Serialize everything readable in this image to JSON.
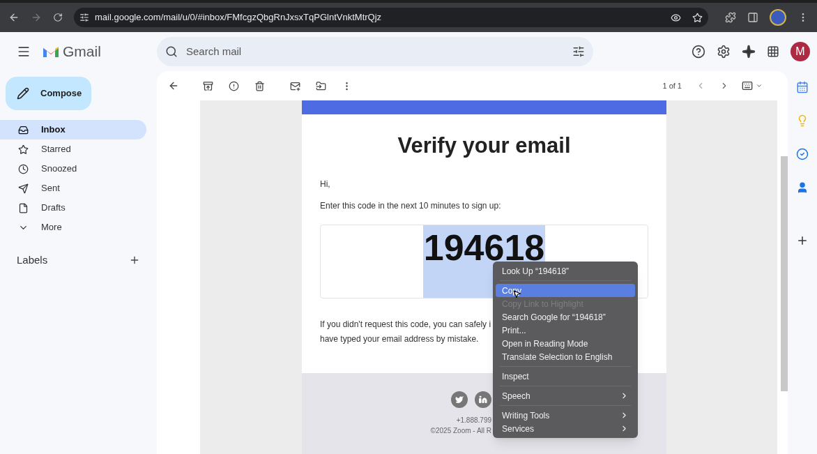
{
  "browser": {
    "url": "mail.google.com/mail/u/0/#inbox/FMfcgzQbgRnJxsxTqPGlntVnktMtrQjz"
  },
  "header": {
    "app_name": "Gmail",
    "search": {
      "placeholder": "Search mail"
    },
    "avatar": "M"
  },
  "sidebar": {
    "compose": "Compose",
    "items": [
      {
        "label": "Inbox",
        "selected": true
      },
      {
        "label": "Starred",
        "selected": false
      },
      {
        "label": "Snoozed",
        "selected": false
      },
      {
        "label": "Sent",
        "selected": false
      },
      {
        "label": "Drafts",
        "selected": false
      },
      {
        "label": "More",
        "selected": false
      }
    ],
    "labels_heading": "Labels"
  },
  "toolbar": {
    "pager": "1 of 1"
  },
  "email": {
    "title": "Verify your email",
    "greeting": "Hi,",
    "instruction": "Enter this code in the next 10 minutes to sign up:",
    "code": {
      "text": "194618",
      "selected": true
    },
    "notice_lines": [
      "If you didn't request this code, you can safely i",
      "have typed your email address by mistake."
    ],
    "footer": {
      "phone": "+1.888.799",
      "copyright": "©2025 Zoom - All R"
    }
  },
  "context_menu": {
    "items": [
      {
        "kind": "item",
        "label": "Look Up “194618”",
        "selected": false,
        "disabled": false,
        "submenu": false
      },
      {
        "kind": "separator"
      },
      {
        "kind": "item",
        "label": "Copy",
        "selected": true,
        "disabled": false,
        "submenu": false
      },
      {
        "kind": "item",
        "label": "Copy Link to Highlight",
        "selected": false,
        "disabled": true,
        "submenu": false
      },
      {
        "kind": "item",
        "label": "Search Google for “194618”",
        "selected": false,
        "disabled": false,
        "submenu": false
      },
      {
        "kind": "item",
        "label": "Print...",
        "selected": false,
        "disabled": false,
        "submenu": false
      },
      {
        "kind": "item",
        "label": "Open in Reading Mode",
        "selected": false,
        "disabled": false,
        "submenu": false
      },
      {
        "kind": "item",
        "label": "Translate Selection to English",
        "selected": false,
        "disabled": false,
        "submenu": false
      },
      {
        "kind": "separator"
      },
      {
        "kind": "item",
        "label": "Inspect",
        "selected": false,
        "disabled": false,
        "submenu": false
      },
      {
        "kind": "separator"
      },
      {
        "kind": "item",
        "label": "Speech",
        "selected": false,
        "disabled": false,
        "submenu": true
      },
      {
        "kind": "separator"
      },
      {
        "kind": "item",
        "label": "Writing Tools",
        "selected": false,
        "disabled": false,
        "submenu": true
      },
      {
        "kind": "item",
        "label": "Services",
        "selected": false,
        "disabled": false,
        "submenu": true
      }
    ]
  }
}
